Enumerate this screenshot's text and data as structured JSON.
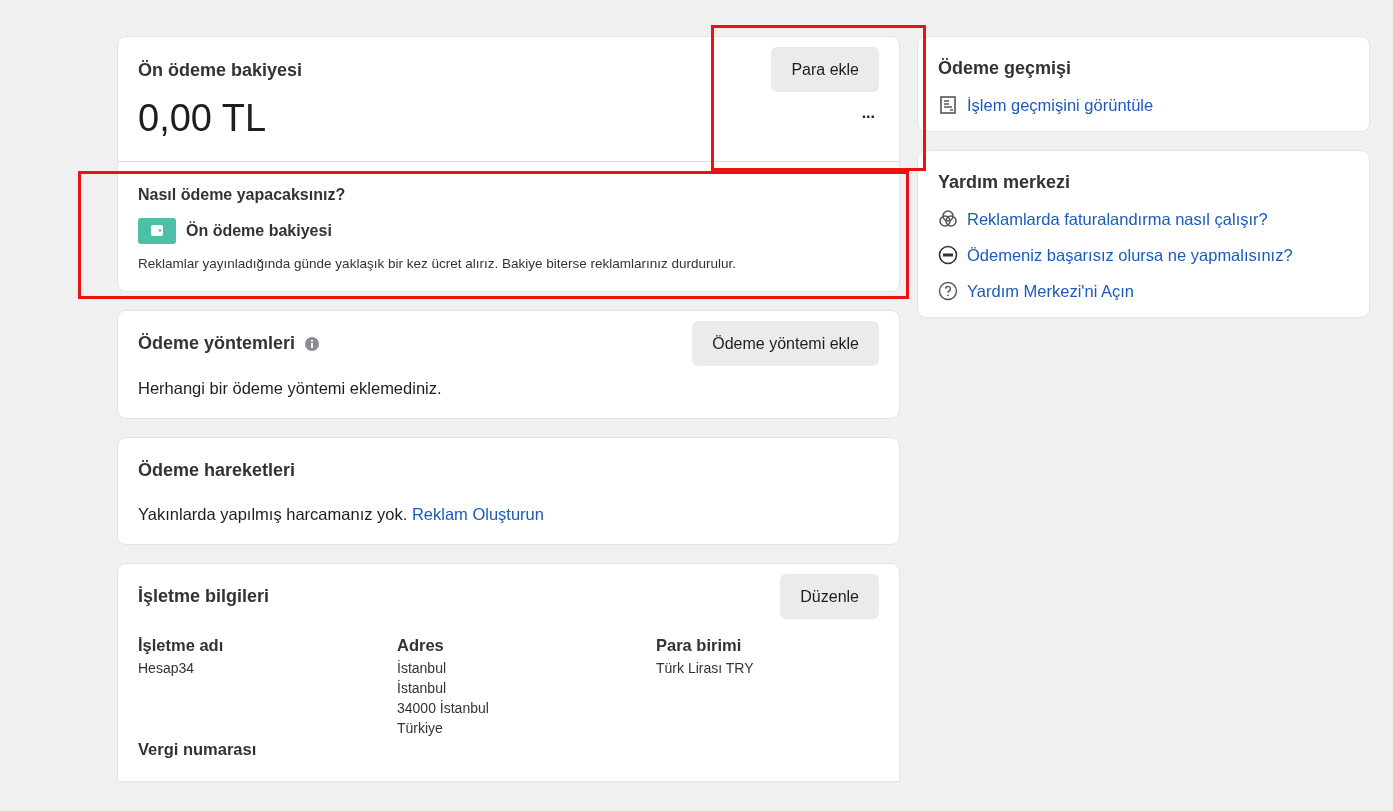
{
  "balance": {
    "title": "Ön ödeme bakiyesi",
    "amount": "0,00 TL",
    "add_button": "Para ekle",
    "more_button": "...",
    "highlighted": true
  },
  "how_to_pay": {
    "title": "Nasıl ödeme yapacaksınız?",
    "method": "Ön ödeme bakiyesi",
    "note": "Reklamlar yayınladığında günde yaklaşık bir kez ücret alırız. Bakiye biterse reklamlarınız durdurulur.",
    "highlighted": true
  },
  "payment_methods": {
    "title": "Ödeme yöntemleri",
    "add_button": "Ödeme yöntemi ekle",
    "empty_text": "Herhangi bir ödeme yöntemi eklemediniz."
  },
  "payment_activity": {
    "title": "Ödeme hareketleri",
    "text": "Yakınlarda yapılmış harcamanız yok.",
    "link": "Reklam Oluşturun"
  },
  "business_info": {
    "title": "İşletme bilgileri",
    "edit_button": "Düzenle",
    "fields": [
      {
        "label": "İşletme adı",
        "lines": [
          "Hesap34"
        ]
      },
      {
        "label": "Adres",
        "lines": [
          "İstanbul",
          "İstanbul",
          "34000 İstanbul",
          "Türkiye"
        ]
      },
      {
        "label": "Para birimi",
        "lines": [
          "Türk Lirası TRY"
        ]
      },
      {
        "label": "Vergi numarası"
      }
    ]
  },
  "payment_history": {
    "title": "Ödeme geçmişi",
    "links": [
      {
        "kind": "receipt",
        "label": "İşlem geçmişini görüntüle"
      }
    ]
  },
  "help_center": {
    "title": "Yardım merkezi",
    "links": [
      {
        "kind": "rings",
        "label": "Reklamlarda faturalandırma nasıl çalışır?"
      },
      {
        "kind": "minus",
        "label": "Ödemeniz başarısız olursa ne yapmalısınız?"
      },
      {
        "kind": "question",
        "label": "Yardım Merkezi'ni Açın"
      }
    ]
  }
}
